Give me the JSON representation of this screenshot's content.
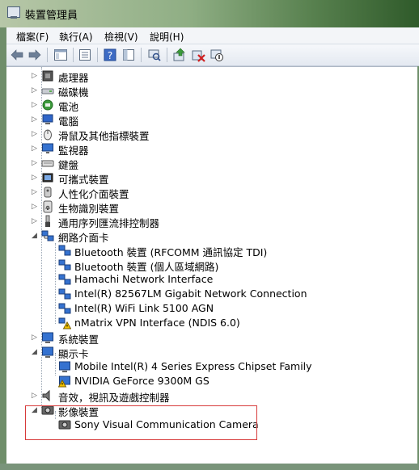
{
  "window": {
    "title": "裝置管理員"
  },
  "menu": [
    "檔案(F)",
    "執行(A)",
    "檢視(V)",
    "說明(H)"
  ],
  "toolbar": {
    "buttons": [
      "back-icon",
      "forward-icon",
      "console-tree-icon",
      "properties-sheet-icon",
      "help-icon",
      "show-hide-icon",
      "scan-hardware-icon",
      "update-driver-icon",
      "uninstall-icon",
      "disable-icon"
    ]
  },
  "tree": {
    "processors": "處理器",
    "disk_drives": "磁碟機",
    "battery": "電池",
    "computer": "電腦",
    "mice": "滑鼠及其他指標裝置",
    "monitors": "監視器",
    "keyboards": "鍵盤",
    "portable": "可攜式裝置",
    "hid": "人性化介面裝置",
    "biometric": "生物識別裝置",
    "usb": "通用序列匯流排控制器",
    "network": "網路介面卡",
    "network_children": [
      "Bluetooth 裝置 (RFCOMM 通訊協定 TDI)",
      "Bluetooth 裝置 (個人區域網路)",
      "Hamachi Network Interface",
      "Intel(R) 82567LM Gigabit Network Connection",
      "Intel(R) WiFi Link 5100 AGN",
      "nMatrix VPN Interface (NDIS 6.0)"
    ],
    "system": "系統裝置",
    "display": "顯示卡",
    "display_children": [
      "Mobile Intel(R) 4 Series Express Chipset Family",
      "NVIDIA GeForce 9300M GS"
    ],
    "sound": "音效，視訊及遊戲控制器",
    "imaging": "影像裝置",
    "imaging_children": [
      "Sony Visual Communication Camera"
    ]
  },
  "colors": {
    "highlight_box": "#d73a3a",
    "warning": "#f2c200"
  }
}
